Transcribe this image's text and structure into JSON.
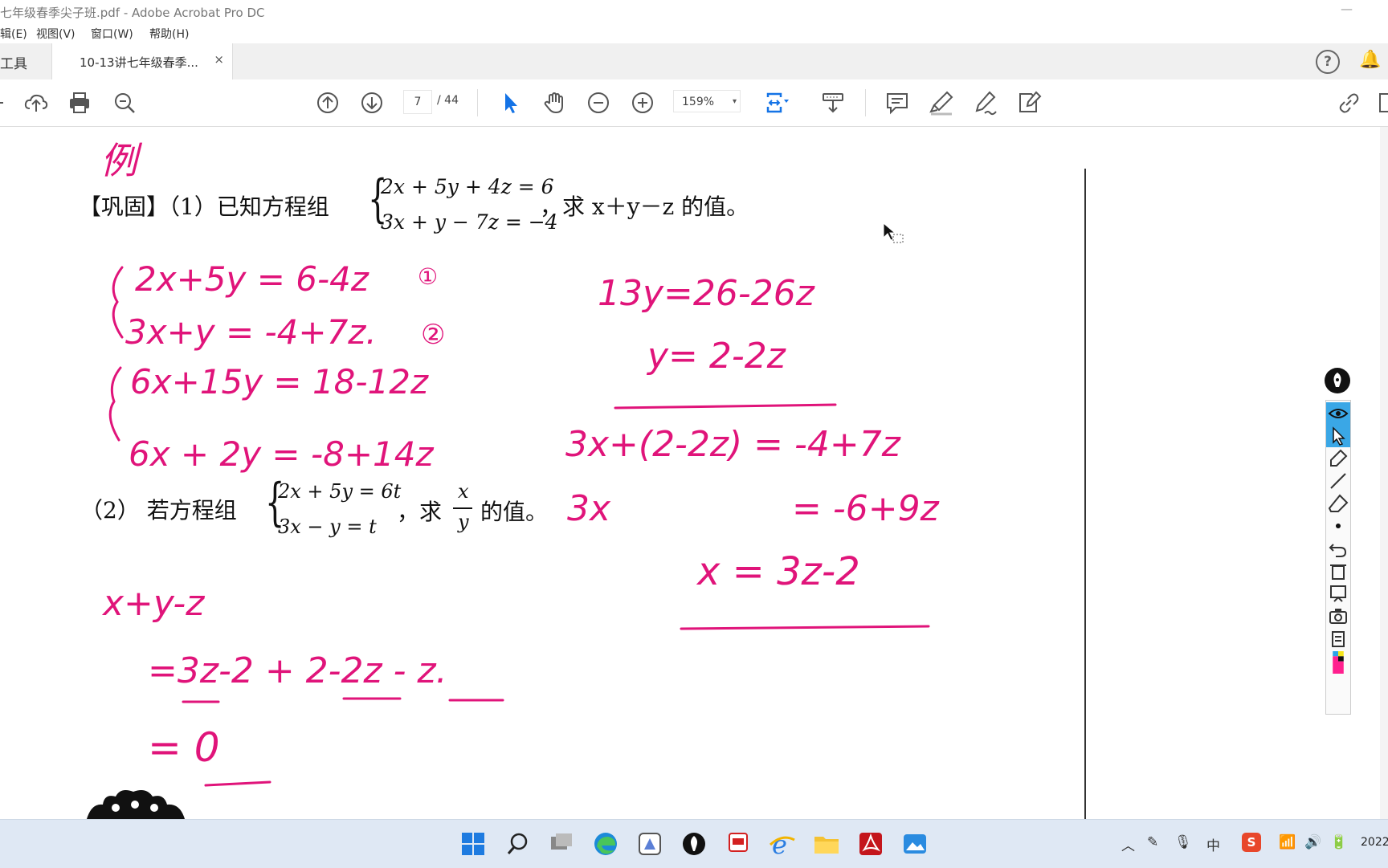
{
  "window": {
    "title": "七年级春季尖子班.pdf - Adobe Acrobat Pro DC",
    "minimize_symbol": "—"
  },
  "menu": [
    "辑(E)",
    "视图(V)",
    "窗口(W)",
    "帮助(H)"
  ],
  "tabs": {
    "tools_label": "工具",
    "doc_tab_label": "10-13讲七年级春季...",
    "close_symbol": "×"
  },
  "toolbar": {
    "current_page": "7",
    "page_total": "/ 44",
    "zoom": "159%",
    "zoom_arrow": "▾",
    "accent_color": "#1473e6"
  },
  "document": {
    "handwritten_title": "例",
    "problem1": {
      "prefix": "【巩固】（1）已知方程组",
      "eq1": "2x + 5y + 4z = 6",
      "eq2": "3x + y − 7z = −4",
      "suffix": "，求 x＋y－z 的值。"
    },
    "problem2": {
      "prefix": "（2）  若方程组",
      "eq1": "2x + 5y = 6t",
      "eq2": "3x − y = t",
      "suffix_a": "，求",
      "frac_num": "x",
      "frac_den": "y",
      "suffix_b": "的值。"
    },
    "ink_color": "#e0147a",
    "ink": {
      "left_system1_a": "2x+5y = 6-4z",
      "left_system1_b": "3x+y = -4+7z.",
      "mark1": "①",
      "mark2": "②",
      "left_system2_a": "6x+15y = 18-12z",
      "left_system2_b": "6x + 2y = -8+14z",
      "right_1": "13y=26-26z",
      "right_2": "y= 2-2z",
      "right_3": "3x+(2-2z) = -4+7z",
      "right_4a": "3x",
      "right_4b": "= -6+9z",
      "right_5": "x = 3z-2",
      "bottom_1": "x+y-z",
      "bottom_2": "=3z-2 + 2-2z - z.",
      "bottom_3": "= 0"
    }
  },
  "taskbar": {
    "clock": "2022",
    "ime_label": "中"
  }
}
